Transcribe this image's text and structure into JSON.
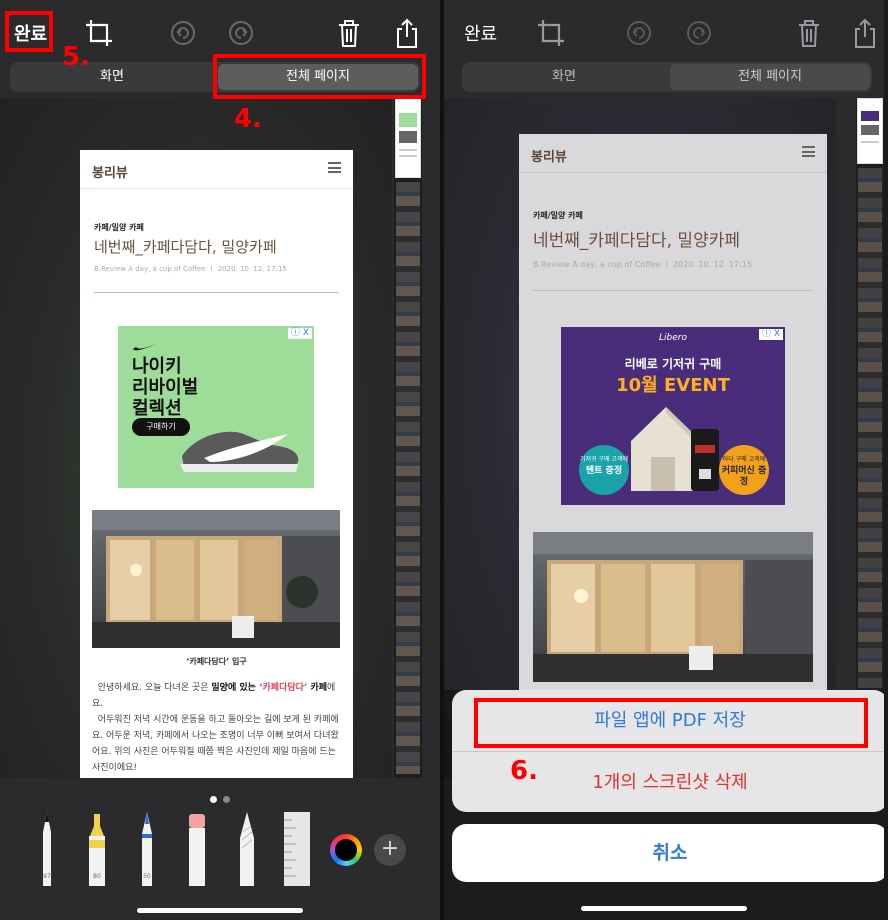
{
  "left": {
    "toolbar": {
      "done_label": "완료"
    },
    "segments": {
      "screen": "화면",
      "full_page": "전체 페이지"
    },
    "page": {
      "brand": "봉리뷰",
      "category": "카페/밀양 카페",
      "title": "네번째_카페다담다, 밀양카페",
      "meta_author": "B.Review A day, a cup of Coffee",
      "meta_sep": "I",
      "meta_date": "2020. 10. 12. 17:15",
      "ad": {
        "close": "ⓘ X",
        "headline": "나이키\n리바이벌\n컬렉션",
        "button": "구매하기"
      },
      "caption": "‘카페다담다’ 입구",
      "body": {
        "p1a": "안녕하세요. 오늘 다녀온 곳은 ",
        "p1b": "밀양에 있는",
        "p1c": " ‘카페다담다’",
        "p1d": " 카페",
        "p1e": "에요.",
        "p2": "어두워진 저녁 시간에 운동을 하고 돌아오는 길에 보게 된 카페에요. 어두운 저녁, 카페에서 나오는 조명이 너무 이뻐 보여서 다녀왔어요. 위의 사진은 어두워질 때쯤 찍은 사진인데 제일 마음에 드는 사진이에요!"
      }
    },
    "tools": {
      "pen_label": "97",
      "marker_label": "80",
      "pencil_label": "50"
    },
    "annotations": {
      "step5": "5.",
      "step4": "4."
    }
  },
  "right": {
    "toolbar": {
      "done_label": "완료"
    },
    "segments": {
      "screen": "화면",
      "full_page": "전체 페이지"
    },
    "page": {
      "brand": "봉리뷰",
      "category": "카페/밀양 카페",
      "title": "네번째_카페다담다, 밀양카페",
      "meta_author": "B.Review A day, a cup of Coffee",
      "meta_sep": "I",
      "meta_date": "2020. 10. 12. 17:15",
      "ad": {
        "close": "ⓘ X",
        "logo": "Libero",
        "line1": "리베로 기저귀 구매",
        "line2": "10월 EVENT",
        "badge_left_small": "기저귀 구매 고객에",
        "badge_left_big": "텐트 증정",
        "badge_right_small": "타다 구매 고객에",
        "badge_right_big": "커피머신 증정"
      }
    },
    "sheet": {
      "save_pdf": "파일 앱에 PDF 저장",
      "delete": "1개의 스크린샷 삭제",
      "cancel": "취소"
    },
    "annotations": {
      "step6": "6."
    }
  },
  "colors": {
    "annotation_red": "#ff0000",
    "ios_blue": "#2f7ad6",
    "destructive_red": "#e0312a",
    "nike_green": "#9edc9a",
    "libero_purple": "#4a2d7a"
  },
  "icons": [
    "crop-icon",
    "undo-icon",
    "redo-icon",
    "trash-icon",
    "share-icon",
    "menu-icon",
    "plus-icon"
  ]
}
